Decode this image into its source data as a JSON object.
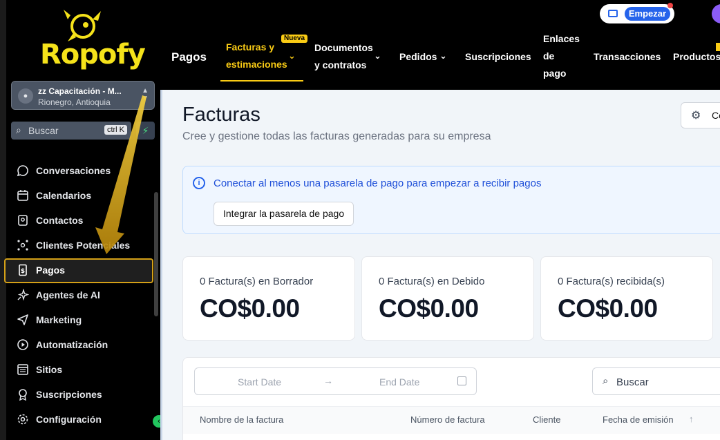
{
  "brand": {
    "name": "Ropofy"
  },
  "location": {
    "name": "zz Capacitación - M...",
    "city": "Rionegro, Antioquia"
  },
  "sidebar_search": {
    "placeholder": "Buscar",
    "shortcut": "ctrl K"
  },
  "sidebar": {
    "items": [
      {
        "label": "Conversaciones",
        "icon": "chat-bubble-icon"
      },
      {
        "label": "Calendarios",
        "icon": "calendar-icon"
      },
      {
        "label": "Contactos",
        "icon": "contacts-book-icon"
      },
      {
        "label": "Clientes Potenciales",
        "icon": "network-icon"
      },
      {
        "label": "Pagos",
        "icon": "invoice-dollar-icon",
        "active": true
      },
      {
        "label": "Agentes de AI",
        "icon": "sparkle-icon"
      },
      {
        "label": "Marketing",
        "icon": "send-icon"
      },
      {
        "label": "Automatización",
        "icon": "play-circle-icon"
      },
      {
        "label": "Sitios",
        "icon": "browser-window-icon"
      },
      {
        "label": "Suscripciones",
        "icon": "award-badge-icon"
      },
      {
        "label": "Configuración",
        "icon": "gear-icon"
      }
    ]
  },
  "topnav": {
    "section": "Pagos",
    "tab_facturas_line1": "Facturas y",
    "tab_facturas_line2": "estimaciones",
    "badge_new": "Nueva",
    "tab_documentos_line1": "Documentos",
    "tab_documentos_line2": "y contratos",
    "tab_pedidos": "Pedidos",
    "tab_suscripciones": "Suscripciones",
    "tab_enlaces_line1": "Enlaces",
    "tab_enlaces_line2": "de",
    "tab_enlaces_line3": "pago",
    "tab_transacciones": "Transacciones",
    "tab_productos": "Productos",
    "empezar": "Empezar"
  },
  "page": {
    "title": "Facturas",
    "subtitle": "Cree y gestione todas las facturas generadas para su empresa",
    "config_button": "Co"
  },
  "alert": {
    "text": "Conectar al menos una pasarela de pago para empezar a recibir pagos",
    "button": "Integrar la pasarela de pago"
  },
  "kpis": [
    {
      "label": "0 Factura(s) en Borrador",
      "value": "CO$0.00"
    },
    {
      "label": "0 Factura(s) en Debido",
      "value": "CO$0.00"
    },
    {
      "label": "0 Factura(s) recibida(s)",
      "value": "CO$0.00"
    }
  ],
  "filters": {
    "start_date": "Start Date",
    "end_date": "End Date",
    "search_placeholder": "Buscar"
  },
  "table": {
    "columns": [
      "Nombre de la factura",
      "Número de factura",
      "Cliente",
      "Fecha de emisión"
    ]
  },
  "colors": {
    "accent": "#facc15",
    "primary": "#2563eb",
    "sidebar_bg": "#000000",
    "highlight_border": "#d4a017"
  }
}
